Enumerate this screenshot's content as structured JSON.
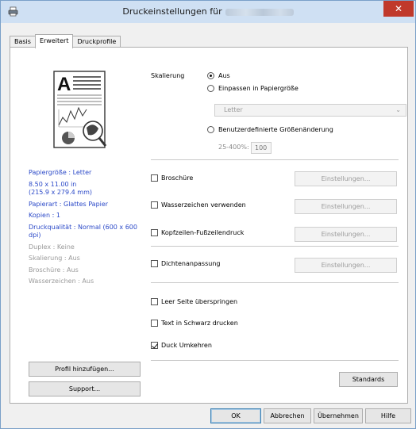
{
  "window": {
    "title": "Druckeinstellungen für",
    "close_glyph": "✕"
  },
  "tabs": [
    {
      "label": "Basis"
    },
    {
      "label": "Erweitert"
    },
    {
      "label": "Druckprofile"
    }
  ],
  "summary": {
    "paper_size": "Papiergröße : Letter",
    "dimensions": "8.50 x 11.00 in\n(215.9 x 279.4 mm)",
    "paper_type": "Papierart : Glattes Papier",
    "copies": "Kopien : 1",
    "quality": "Druckqualität : Normal (600 x 600 dpi)",
    "duplex": "Duplex : Keine",
    "scaling": "Skalierung : Aus",
    "booklet": "Broschüre : Aus",
    "watermark": "Wasserzeichen : Aus"
  },
  "left_buttons": {
    "add_profile": "Profil hinzufügen...",
    "support": "Support..."
  },
  "scaling": {
    "label": "Skalierung",
    "off": "Aus",
    "fit": "Einpassen in Papiergröße",
    "paper_select": "Letter",
    "custom": "Benutzerdefinierte Größenänderung",
    "range": "25-400%:",
    "value": "100"
  },
  "options": {
    "booklet": "Broschüre",
    "watermark": "Wasserzeichen verwenden",
    "header_footer": "Kopfzeilen-Fußzeilendruck",
    "density": "Dichtenanpassung",
    "skip_blank": "Leer Seite überspringen",
    "black_text": "Text in Schwarz drucken",
    "reverse": "Duck Umkehren",
    "settings_label": "Einstellungen..."
  },
  "defaults_button": "Standards",
  "footer": {
    "ok": "OK",
    "cancel": "Abbrechen",
    "apply": "Übernehmen",
    "help": "Hilfe"
  }
}
